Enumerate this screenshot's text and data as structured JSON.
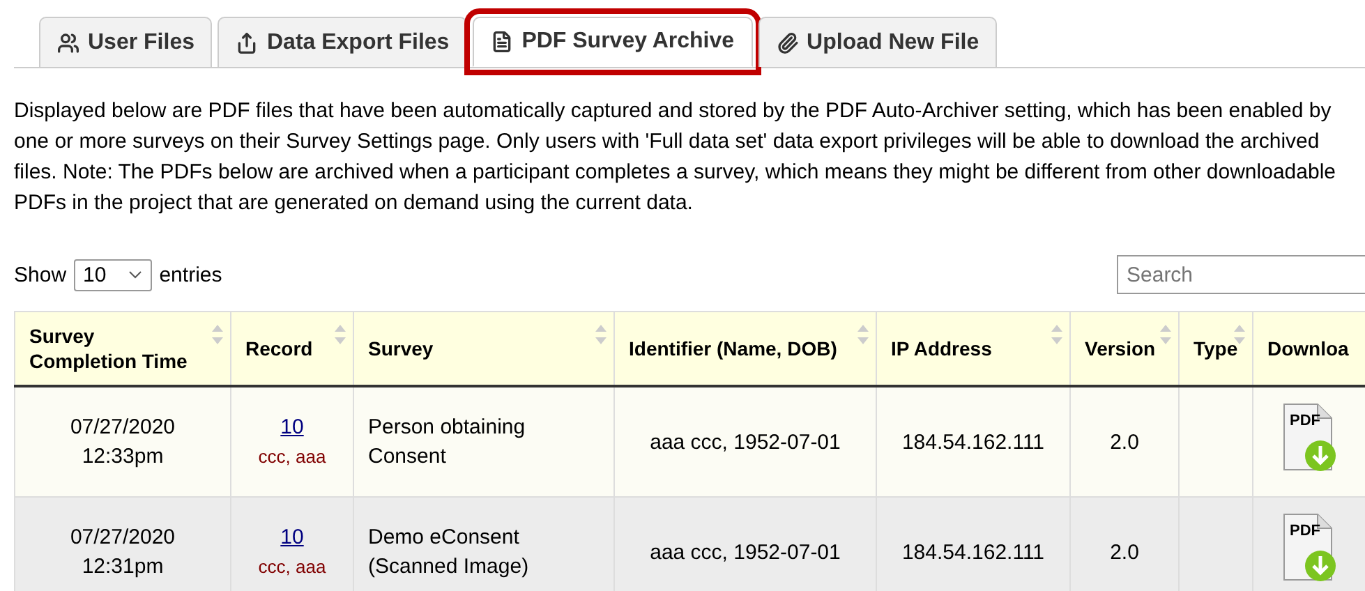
{
  "tabs": [
    {
      "label": "User Files",
      "selected": false
    },
    {
      "label": "Data Export Files",
      "selected": false
    },
    {
      "label": "PDF Survey Archive",
      "selected": true
    },
    {
      "label": "Upload New File",
      "selected": false
    }
  ],
  "description": "Displayed below are PDF files that have been automatically captured and stored by the PDF Auto-Archiver setting, which has been enabled by one or more surveys on their Survey Settings page. Only users with 'Full data set' data export privileges will be able to download the archived files. Note: The PDFs below are archived when a participant completes a survey, which means they might be different from other downloadable PDFs in the project that are generated on demand using the current data.",
  "length_control": {
    "before": "Show",
    "value": "10",
    "after": "entries"
  },
  "search": {
    "placeholder": "Search"
  },
  "table": {
    "columns": [
      "Survey Completion Time",
      "Record",
      "Survey",
      "Identifier (Name, DOB)",
      "IP Address",
      "Version",
      "Type",
      "Downloa"
    ],
    "rows": [
      {
        "time": [
          "07/27/2020",
          "12:33pm"
        ],
        "record": "10",
        "record_name": "ccc, aaa",
        "survey": "Person obtaining Consent",
        "identifier": "aaa ccc, 1952-07-01",
        "ip": "184.54.162.111",
        "version": "2.0",
        "download_label": "PDF"
      },
      {
        "time": [
          "07/27/2020",
          "12:31pm"
        ],
        "record": "10",
        "record_name": "ccc, aaa",
        "survey": "Demo eConsent (Scanned Image)",
        "identifier": "aaa ccc, 1952-07-01",
        "ip": "184.54.162.111",
        "version": "2.0",
        "download_label": "PDF"
      }
    ]
  }
}
